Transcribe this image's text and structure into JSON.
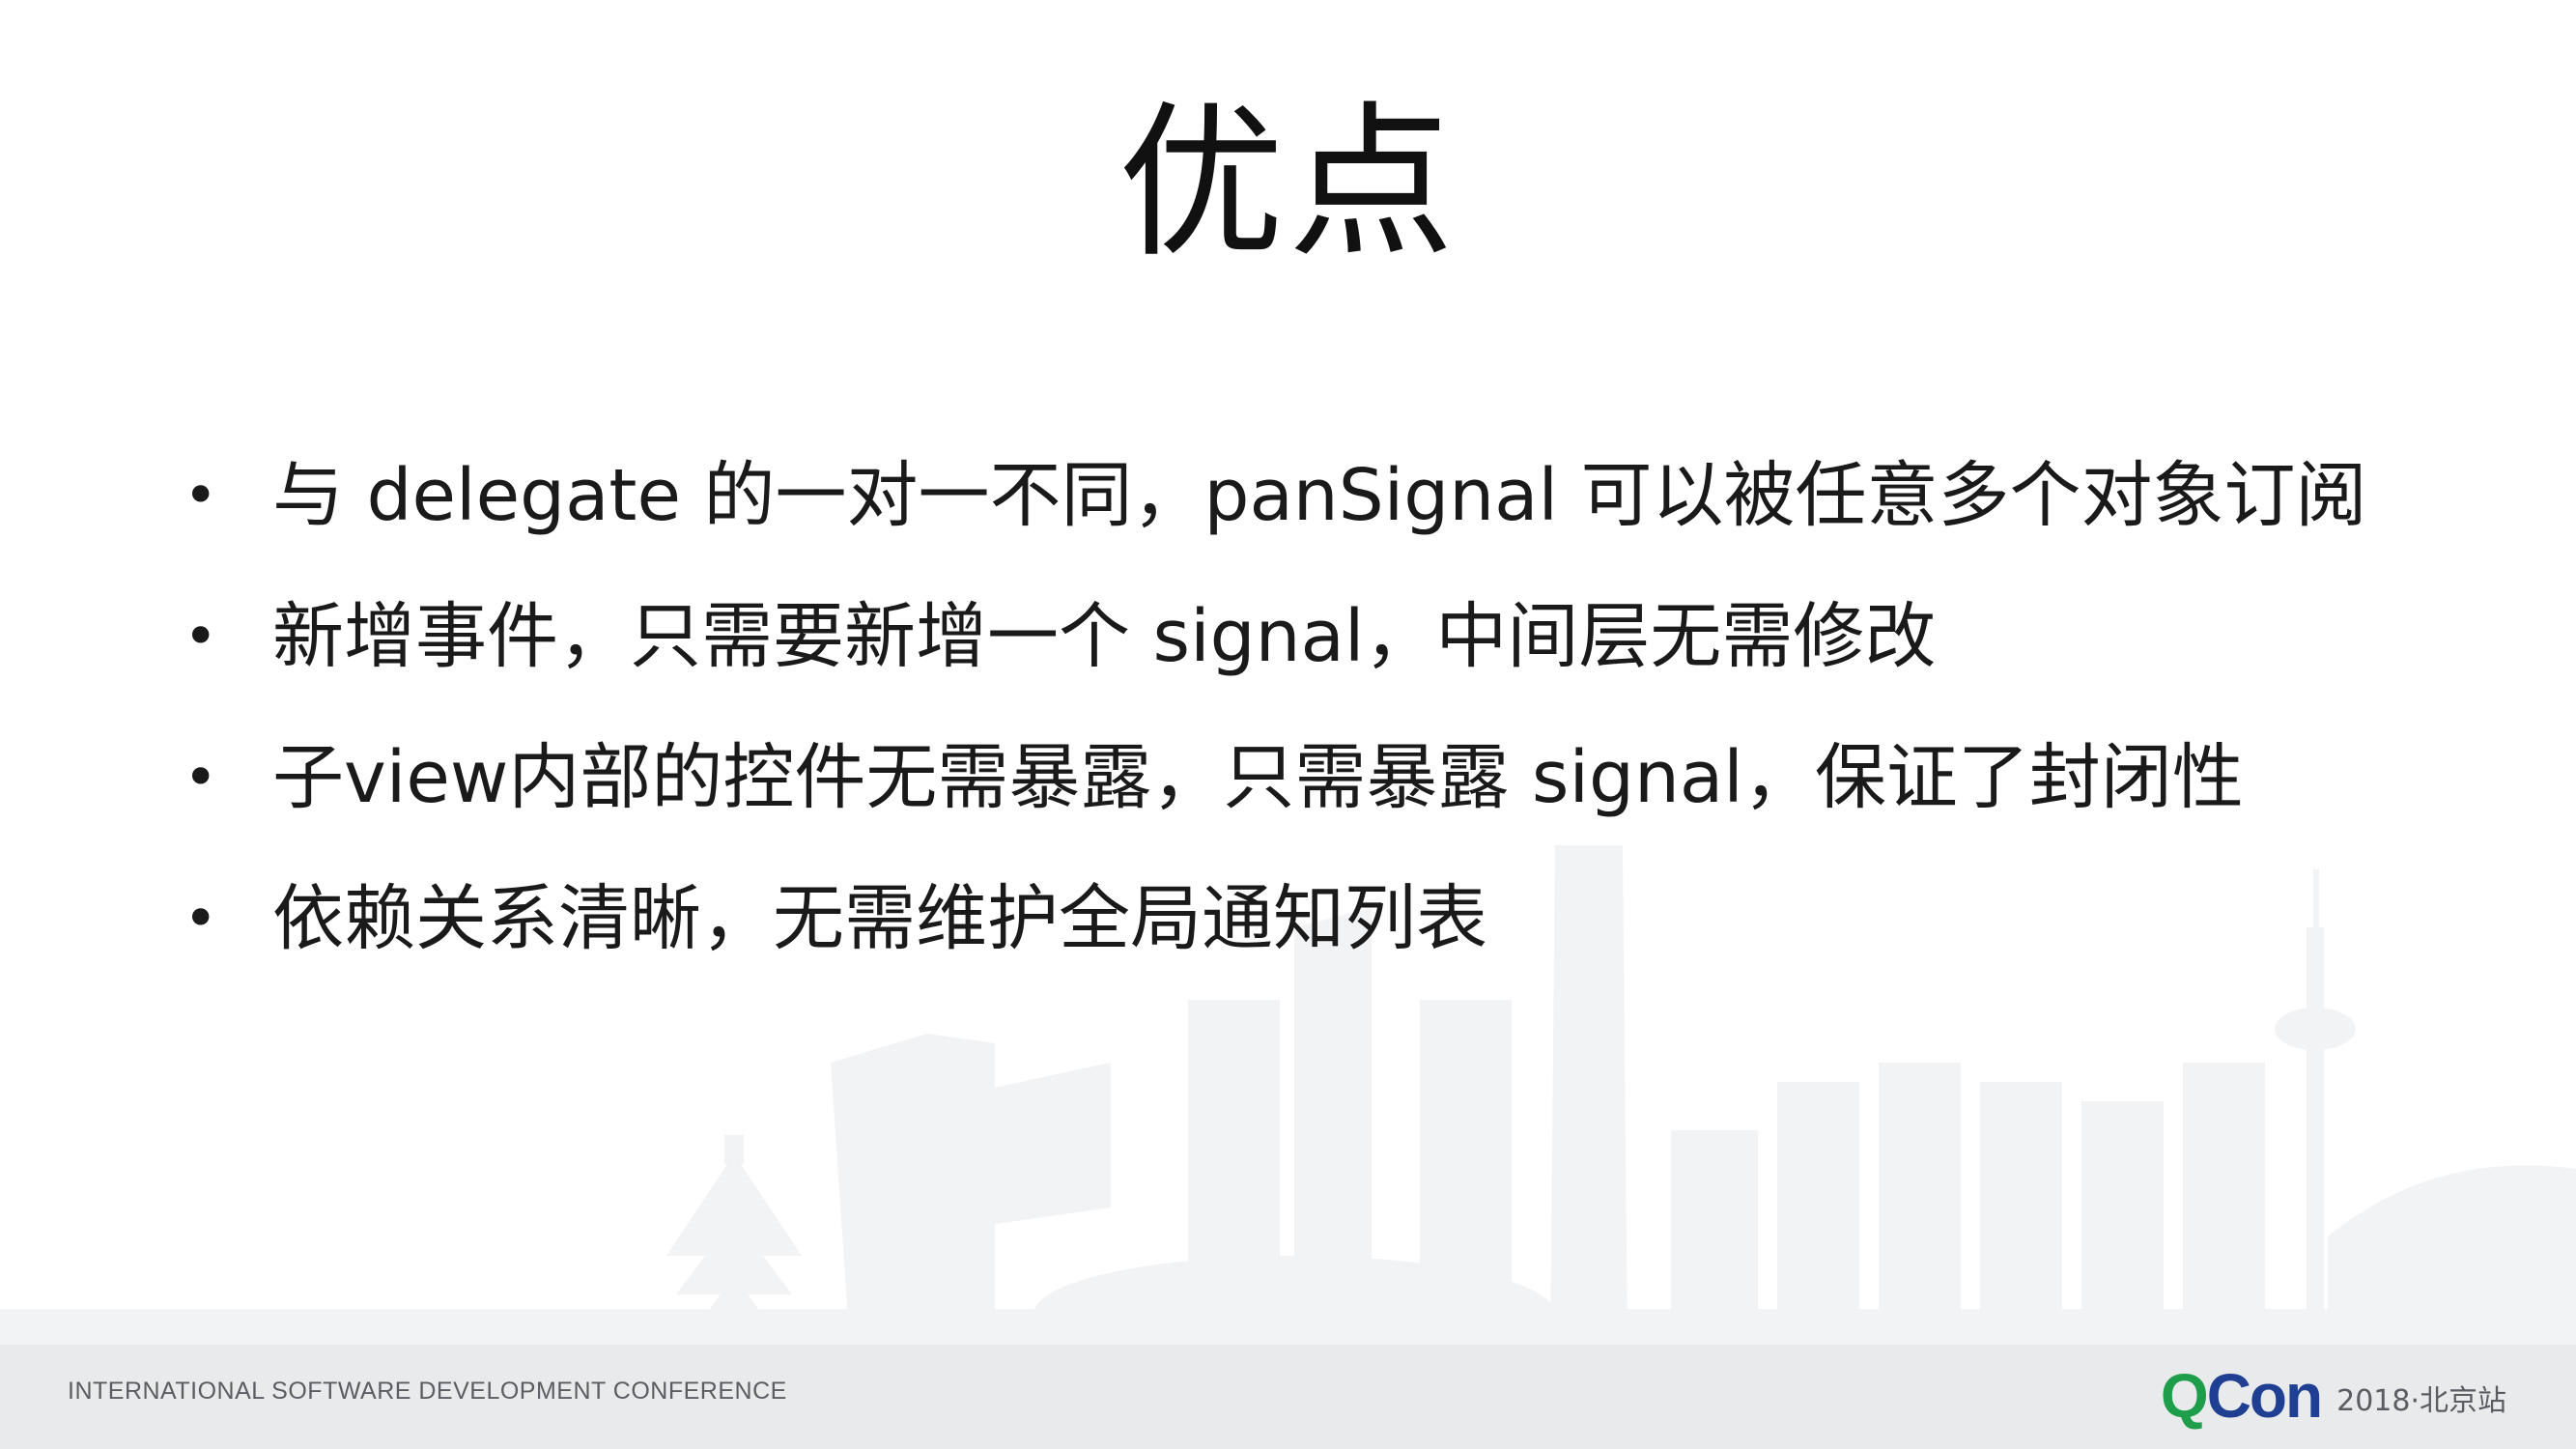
{
  "slide": {
    "title": "优点",
    "bullets": [
      {
        "marker": "•",
        "text": "与 delegate 的一对一不同，panSignal 可以被任意多个对象订阅"
      },
      {
        "marker": "•",
        "text": "新增事件，只需要新增一个 signal，中间层无需修改"
      },
      {
        "marker": "•",
        "text": "子view内部的控件无需暴露，只需暴露 signal，保证了封闭性"
      },
      {
        "marker": "•",
        "text": "依赖关系清晰，无需维护全局通知列表"
      }
    ]
  },
  "footer": {
    "conference_name": "INTERNATIONAL SOFTWARE DEVELOPMENT CONFERENCE",
    "logo_q": "Q",
    "logo_rest": "Con",
    "edition": "2018·北京站"
  },
  "colors": {
    "skyline": "#f1f2f4",
    "footer_bg": "#e9eaec",
    "logo_green": "#1e9e4a",
    "logo_blue": "#1f3f93"
  }
}
